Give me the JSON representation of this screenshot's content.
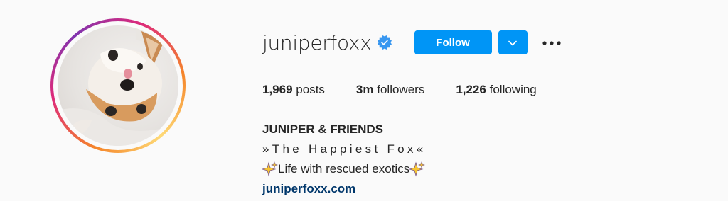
{
  "profile": {
    "username": "juniperfoxx",
    "verified": true,
    "avatar_icon": "fox-avatar",
    "accent": "#0095f6"
  },
  "actions": {
    "follow_label": "Follow",
    "dropdown_icon": "chevron-down-icon",
    "more_icon": "more-dots-icon"
  },
  "stats": {
    "posts_count": "1,969",
    "posts_label": "posts",
    "followers_count": "3m",
    "followers_label": "followers",
    "following_count": "1,226",
    "following_label": "following"
  },
  "bio": {
    "name": "JUNIPER & FRIENDS",
    "tagline": "»The Happiest Fox«",
    "description": "Life with rescued exotics",
    "sparkle_icon": "sparkles-icon",
    "link": "juniperfoxx.com",
    "link_color": "#00376b"
  }
}
